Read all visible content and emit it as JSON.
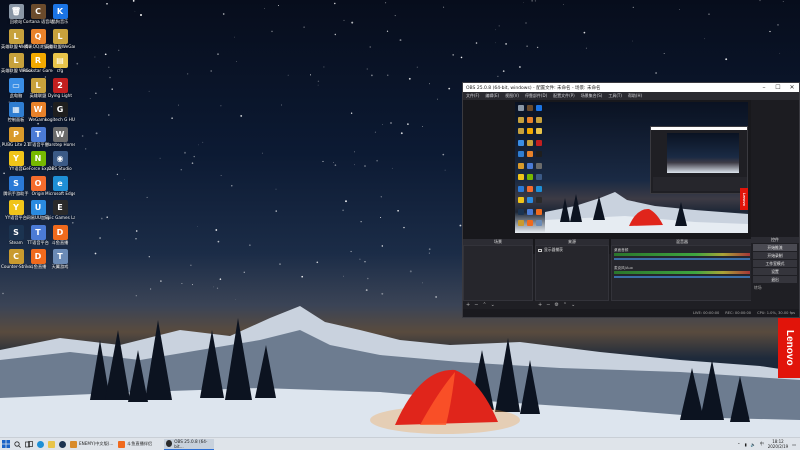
{
  "desktop_icons": [
    {
      "label": "回收站",
      "color": "#8a97a6",
      "glyph": "🗑"
    },
    {
      "label": "Cortana 语音助手",
      "color": "#6b4b2c",
      "glyph": "C"
    },
    {
      "label": "酷狗音乐",
      "color": "#1b74e4",
      "glyph": "K"
    },
    {
      "label": "英雄联盟 WeGame版",
      "color": "#c7a13c",
      "glyph": "L"
    },
    {
      "label": "腾讯QQ浏览器",
      "color": "#e8822a",
      "glyph": "Q"
    },
    {
      "label": "英雄联盟WeGame版",
      "color": "#c7a13c",
      "glyph": "L"
    },
    {
      "label": "英雄联盟 WeGame版",
      "color": "#c7a13c",
      "glyph": "L"
    },
    {
      "label": "Rockstar Games...",
      "color": "#f2a900",
      "glyph": "R"
    },
    {
      "label": "cfg",
      "color": "#e8c44a",
      "glyph": "▤"
    },
    {
      "label": "此电脑",
      "color": "#3a8ee6",
      "glyph": "▭"
    },
    {
      "label": "英雄联盟",
      "color": "#c7a13c",
      "glyph": "L"
    },
    {
      "label": "Dying Light",
      "color": "#c21f1f",
      "glyph": "2"
    },
    {
      "label": "控制面板",
      "color": "#2f7dd1",
      "glyph": "▦"
    },
    {
      "label": "WeGame",
      "color": "#e8822a",
      "glyph": "W"
    },
    {
      "label": "Logitech G HUB",
      "color": "#1e1e1e",
      "glyph": "G"
    },
    {
      "label": "PUBG Lite 2.0",
      "color": "#d99a2b",
      "glyph": "P"
    },
    {
      "label": "TT语音平台",
      "color": "#4b7bd6",
      "glyph": "T"
    },
    {
      "label": "Warstep Homes...",
      "color": "#6b6b6b",
      "glyph": "W"
    },
    {
      "label": "YY语音",
      "color": "#f0c419",
      "glyph": "Y"
    },
    {
      "label": "GeForce Experience",
      "color": "#76b900",
      "glyph": "N"
    },
    {
      "label": "OBS Studio",
      "color": "#3b5a86",
      "glyph": "◉"
    },
    {
      "label": "腾讯手游助手",
      "color": "#2b79d6",
      "glyph": "S"
    },
    {
      "label": "Origin",
      "color": "#f56c2d",
      "glyph": "O"
    },
    {
      "label": "Microsoft Edge",
      "color": "#1e8fd6",
      "glyph": "e"
    },
    {
      "label": "YY语音平台",
      "color": "#f0c419",
      "glyph": "Y"
    },
    {
      "label": "网易UU加速",
      "color": "#2a8be0",
      "glyph": "U"
    },
    {
      "label": "Epic Games Launcher",
      "color": "#2a2a2a",
      "glyph": "E"
    },
    {
      "label": "Steam",
      "color": "#1b3350",
      "glyph": "S"
    },
    {
      "label": "TT语音平台",
      "color": "#4b7bd6",
      "glyph": "T"
    },
    {
      "label": "斗鱼直播",
      "color": "#f06a1d",
      "glyph": "D"
    },
    {
      "label": "Counter-Strike Global Off...",
      "color": "#c99a2e",
      "glyph": "C"
    },
    {
      "label": "斗鱼直播",
      "color": "#f06a1d",
      "glyph": "D"
    },
    {
      "label": "天翼游戏",
      "color": "#6b8bb6",
      "glyph": "T"
    }
  ],
  "obs": {
    "title": "OBS 25.0.8 (64-bit, windows) - 配置文件: 未命名 - 场景: 未命名",
    "menu": [
      "文件(F)",
      "编辑(E)",
      "视图(V)",
      "停靠部件(D)",
      "配置文件(P)",
      "场景集合(S)",
      "工具(T)",
      "帮助(H)"
    ],
    "docks": {
      "scenes": "场景",
      "sources": "来源",
      "mixer": "混音器",
      "controls": "控件"
    },
    "source_item": "显示器捕获",
    "mixer_tracks": [
      "桌面音频",
      "麦克风/Aux"
    ],
    "controls": [
      "开始推流",
      "开始录制",
      "工作室模式",
      "设置",
      "退出"
    ],
    "transition": "转场",
    "status": [
      "LIVE: 00:00:00",
      "REC: 00:00:00",
      "CPU: 1.0%, 30.00 fps"
    ],
    "preview_brand": "Lenovo"
  },
  "wallpaper_brand": "Lenovo",
  "taskbar": {
    "apps": [
      {
        "label": "ENEMY(中文版)...",
        "color": "#d98b2a"
      },
      {
        "label": "斗鱼直播伴侣",
        "color": "#f06a1d"
      },
      {
        "label": "OBS 25.0.8 (64-bit...",
        "color": "#2b2b2b"
      }
    ],
    "time": "18:12",
    "date": "2020/2/19"
  }
}
